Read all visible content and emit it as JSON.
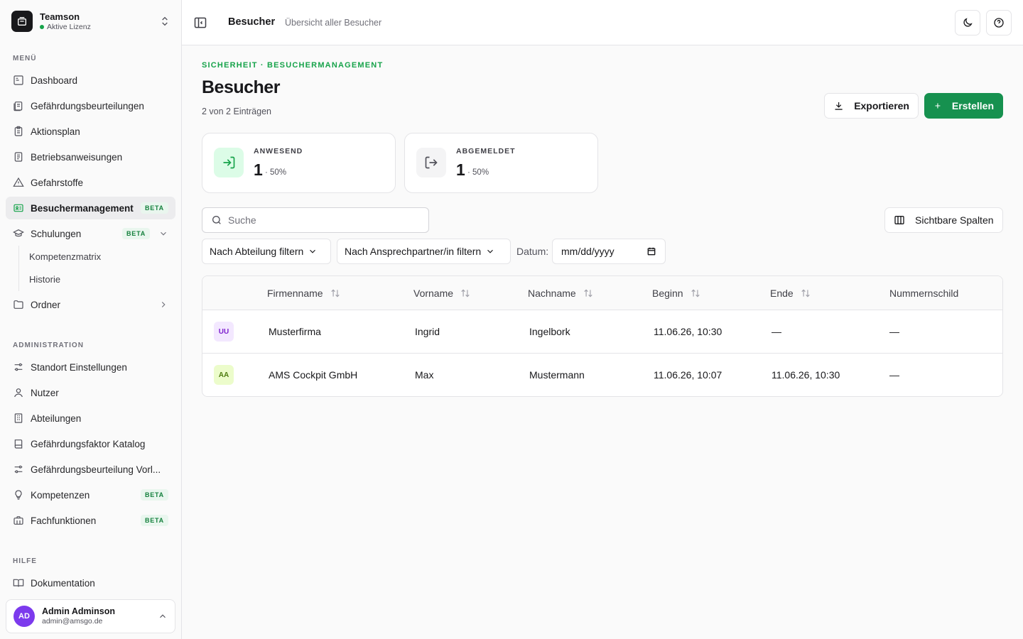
{
  "brand": {
    "name": "Teamson",
    "license": "Aktive Lizenz"
  },
  "sidebar": {
    "menu_label": "MENÜ",
    "menu_items": [
      {
        "label": "Dashboard",
        "icon": "dashboard-icon"
      },
      {
        "label": "Gefährdungsbeurteilungen",
        "icon": "clipboard-list-icon"
      },
      {
        "label": "Aktionsplan",
        "icon": "clipboard-icon"
      },
      {
        "label": "Betriebsanweisungen",
        "icon": "file-text-icon"
      },
      {
        "label": "Gefahrstoffe",
        "icon": "warning-triangle-icon"
      },
      {
        "label": "Besuchermanagement",
        "badge": "BETA",
        "active": true,
        "icon": "id-card-icon"
      },
      {
        "label": "Schulungen",
        "badge": "BETA",
        "icon": "graduation-cap-icon",
        "expanded": true
      }
    ],
    "schulungen_sub": [
      "Kompetenzmatrix",
      "Historie"
    ],
    "ordner_label": "Ordner",
    "admin_label": "ADMINISTRATION",
    "admin_items": [
      {
        "label": "Standort Einstellungen",
        "icon": "sliders-icon"
      },
      {
        "label": "Nutzer",
        "icon": "user-icon"
      },
      {
        "label": "Abteilungen",
        "icon": "building-icon"
      },
      {
        "label": "Gefährdungsfaktor Katalog",
        "icon": "book-icon"
      },
      {
        "label": "Gefährdungsbeurteilung Vorl...",
        "icon": "sliders-icon"
      },
      {
        "label": "Kompetenzen",
        "badge": "BETA",
        "icon": "lightbulb-icon"
      },
      {
        "label": "Fachfunktionen",
        "badge": "BETA",
        "icon": "briefcase-icon"
      }
    ],
    "help_label": "HILFE",
    "help_items": [
      {
        "label": "Dokumentation",
        "icon": "book-open-icon"
      }
    ]
  },
  "user": {
    "initials": "AD",
    "name": "Admin Adminson",
    "email": "admin@amsgo.de"
  },
  "header": {
    "title": "Besucher",
    "subtitle": "Übersicht aller Besucher"
  },
  "page": {
    "eyebrow": "SICHERHEIT · BESUCHERMANAGEMENT",
    "title": "Besucher",
    "count_text": "2 von 2 Einträgen",
    "export_label": "Exportieren",
    "create_label": "Erstellen"
  },
  "stats": [
    {
      "label": "ANWESEND",
      "value": "1",
      "pct": "· 50%"
    },
    {
      "label": "ABGEMELDET",
      "value": "1",
      "pct": "· 50%"
    }
  ],
  "filters": {
    "search_placeholder": "Suche",
    "columns_label": "Sichtbare Spalten",
    "department_filter": "Nach Abteilung filtern",
    "contact_filter": "Nach Ansprechpartner/in filtern",
    "date_label": "Datum:",
    "date_placeholder": "mm/dd/yyyy"
  },
  "table": {
    "columns": [
      "Firmenname",
      "Vorname",
      "Nachname",
      "Beginn",
      "Ende",
      "Nummernschild"
    ],
    "rows": [
      {
        "initials": "UU",
        "company": "Musterfirma",
        "first": "Ingrid",
        "last": "Ingelbork",
        "start": "11.06.26, 10:30",
        "end": "—",
        "plate": "—",
        "avatar_bg": "#f3e8ff",
        "avatar_fg": "#7e22ce"
      },
      {
        "initials": "AA",
        "company": "AMS Cockpit GmbH",
        "first": "Max",
        "last": "Mustermann",
        "start": "11.06.26, 10:07",
        "end": "11.06.26, 10:30",
        "plate": "—",
        "avatar_bg": "#ecfccb",
        "avatar_fg": "#4d7c0f"
      }
    ]
  },
  "colors": {
    "accent": "#16914f",
    "sidebar_bg": "#fafafa",
    "active_bg": "#ececee"
  }
}
